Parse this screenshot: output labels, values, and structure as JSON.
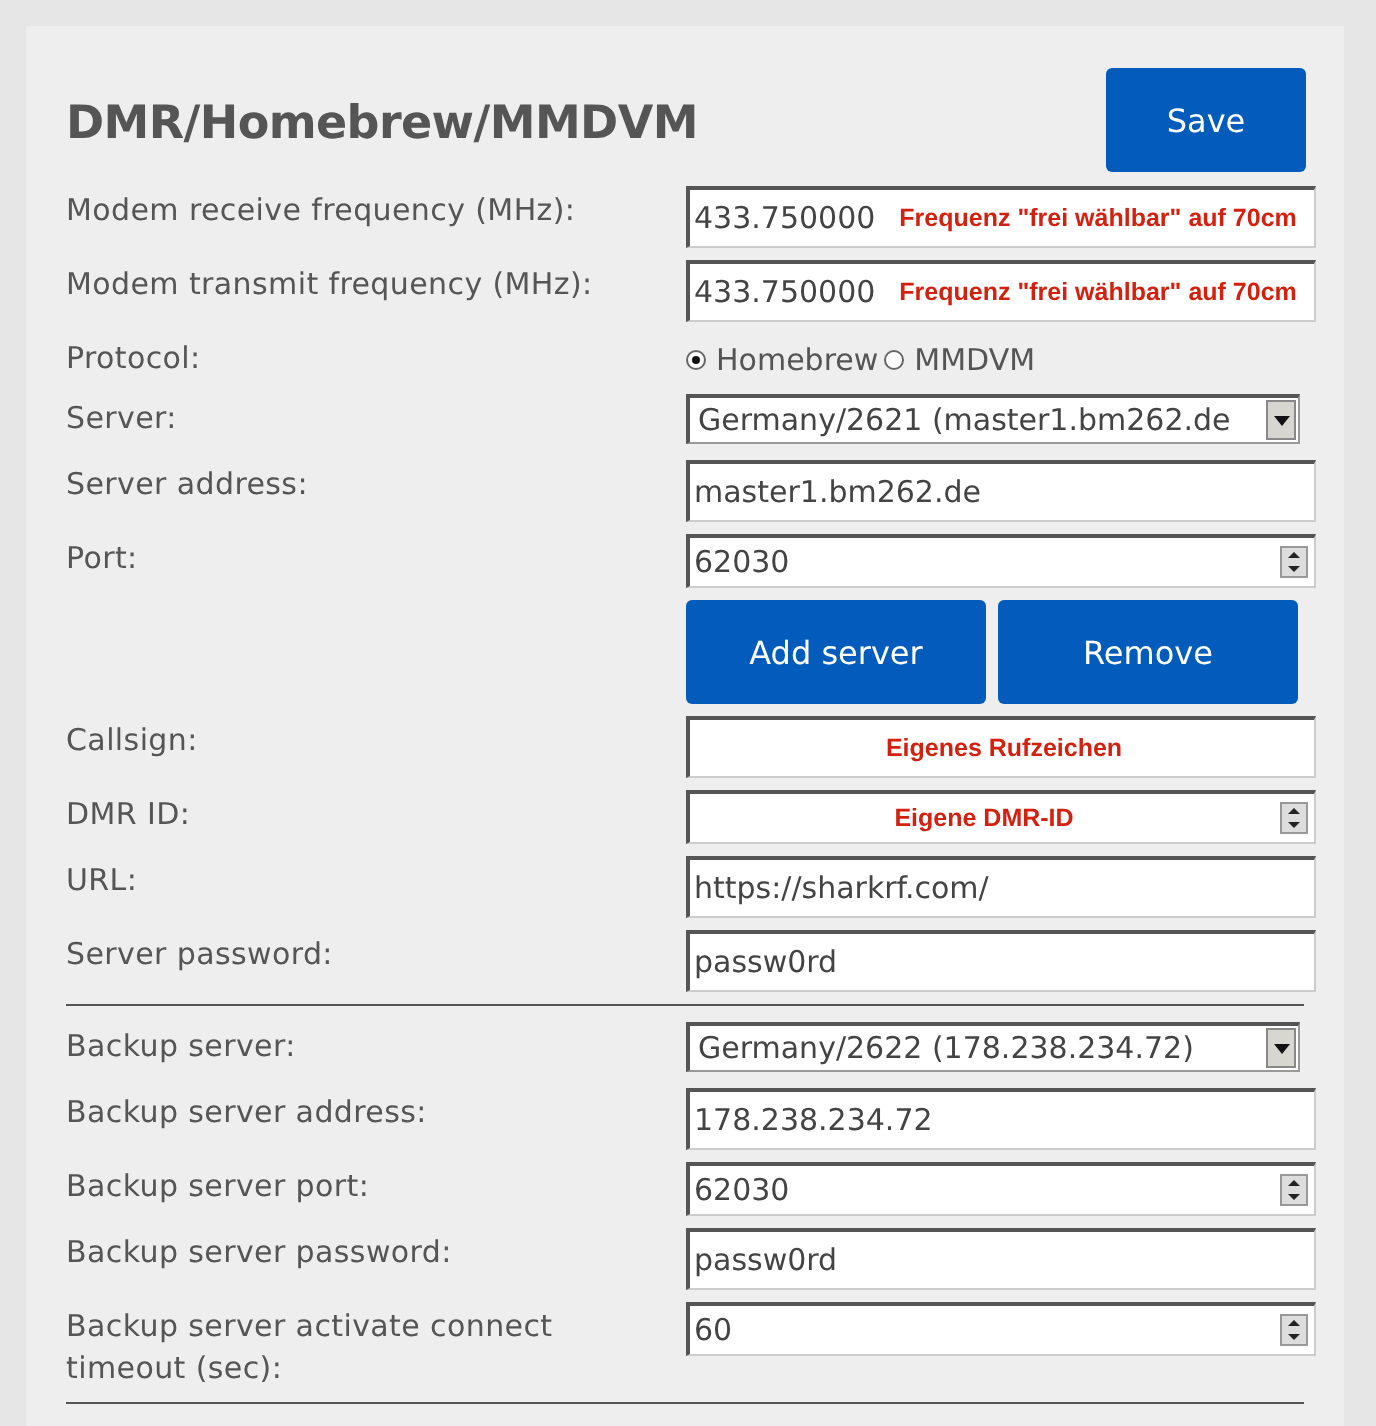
{
  "title": "DMR/Homebrew/MMDVM",
  "save_button": "Save",
  "rows": [
    {
      "kind": "text",
      "label": "Modem receive frequency (MHz):",
      "value": "433.750000",
      "note": "Frequenz \"frei wählbar\" auf 70cm"
    },
    {
      "kind": "text",
      "label": "Modem transmit frequency (MHz):",
      "value": "433.750000",
      "note": "Frequenz \"frei wählbar\" auf 70cm"
    },
    {
      "kind": "radio",
      "label": "Protocol:",
      "options": [
        {
          "label": "Homebrew",
          "selected": true
        },
        {
          "label": "MMDVM",
          "selected": false
        }
      ]
    },
    {
      "kind": "select",
      "label": "Server:",
      "value": "Germany/2621 (master1.bm262.de"
    },
    {
      "kind": "text",
      "label": "Server address:",
      "value": "master1.bm262.de"
    },
    {
      "kind": "number",
      "label": "Port:",
      "value": "62030"
    },
    {
      "kind": "buttons",
      "buttons": [
        "Add server",
        "Remove"
      ]
    },
    {
      "kind": "text",
      "label": "Callsign:",
      "note": "Eigenes Rufzeichen"
    },
    {
      "kind": "number",
      "label": "DMR ID:",
      "note": "Eigene DMR-ID"
    },
    {
      "kind": "text",
      "label": "URL:",
      "value": "https://sharkrf.com/"
    },
    {
      "kind": "text",
      "label": "Server password:",
      "value": "passw0rd"
    },
    {
      "kind": "divider"
    },
    {
      "kind": "select",
      "label": "Backup server:",
      "value": "Germany/2622 (178.238.234.72)"
    },
    {
      "kind": "text",
      "label": "Backup server address:",
      "value": "178.238.234.72"
    },
    {
      "kind": "number",
      "label": "Backup server port:",
      "value": "62030"
    },
    {
      "kind": "text",
      "label": "Backup server password:",
      "value": "passw0rd"
    },
    {
      "kind": "number",
      "label": "Backup server activate connect timeout (sec):",
      "value": "60"
    },
    {
      "kind": "divider"
    }
  ]
}
